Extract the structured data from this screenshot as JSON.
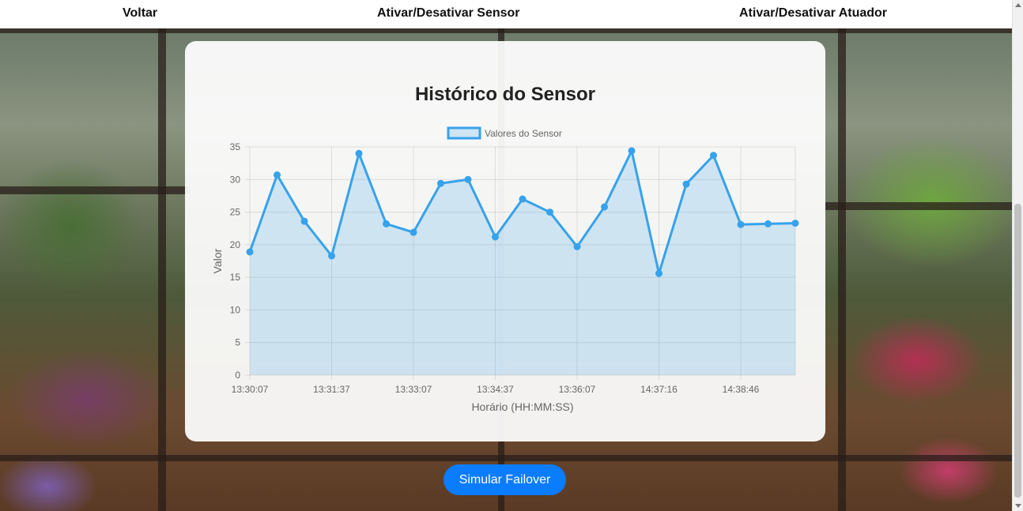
{
  "nav": {
    "back_label": "Voltar",
    "toggle_sensor_label": "Ativar/Desativar Sensor",
    "toggle_actuator_label": "Ativar/Desativar Atuador"
  },
  "chart_card": {
    "title": "Histórico do Sensor"
  },
  "failover_button": {
    "label": "Simular Failover",
    "color": "#0a7cff"
  },
  "chart_data": {
    "type": "line",
    "title": "Histórico do Sensor",
    "xlabel": "Horário (HH:MM:SS)",
    "ylabel": "Valor",
    "ylim": [
      0,
      35
    ],
    "yticks": [
      0,
      5,
      10,
      15,
      20,
      25,
      30,
      35
    ],
    "x_tick_labels": [
      "13:30:07",
      "13:31:37",
      "13:33:07",
      "13:34:37",
      "13:36:07",
      "14:37:16",
      "14:38:46"
    ],
    "series": [
      {
        "name": "Valores do Sensor",
        "color": "#36a2eb",
        "fill": "rgba(54,162,235,0.2)",
        "values": [
          18.9,
          30.7,
          23.6,
          18.3,
          34.0,
          23.2,
          21.9,
          29.4,
          30.0,
          21.2,
          27.0,
          25.0,
          19.7,
          25.8,
          34.4,
          15.6,
          29.3,
          33.7,
          23.1,
          23.2,
          23.3
        ]
      }
    ],
    "grid": true,
    "legend": "top-center"
  }
}
